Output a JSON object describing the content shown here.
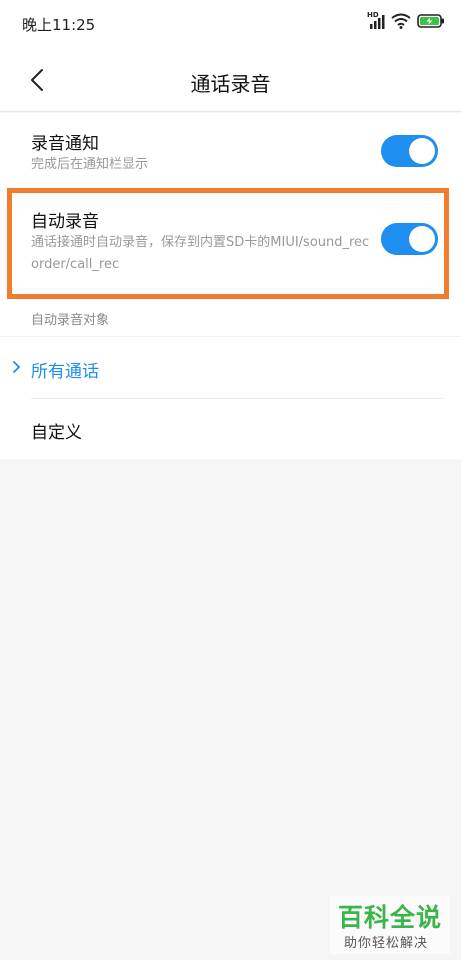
{
  "status_bar": {
    "time": "晚上11:25",
    "hd_badge": "HD",
    "icons": [
      "signal-icon",
      "wifi-icon",
      "battery-charging-icon"
    ]
  },
  "header": {
    "back_icon": "back-chevron-icon",
    "title": "通话录音"
  },
  "settings": [
    {
      "title": "录音通知",
      "subtitle": "完成后在通知栏显示",
      "enabled": true
    },
    {
      "title": "自动录音",
      "subtitle": "通话接通时自动录音，保存到内置SD卡的MIUI/sound_recorder/call_rec",
      "enabled": true
    }
  ],
  "section": {
    "label": "自动录音对象"
  },
  "options": [
    {
      "label": "所有通话",
      "selected": true
    },
    {
      "label": "自定义",
      "selected": false
    }
  ],
  "colors": {
    "accent": "#1e8ef1",
    "highlight": "#f07c2e",
    "watermark": "#3bb54a"
  },
  "watermark": {
    "main": "百科全说",
    "sub": "助你轻松解决"
  }
}
